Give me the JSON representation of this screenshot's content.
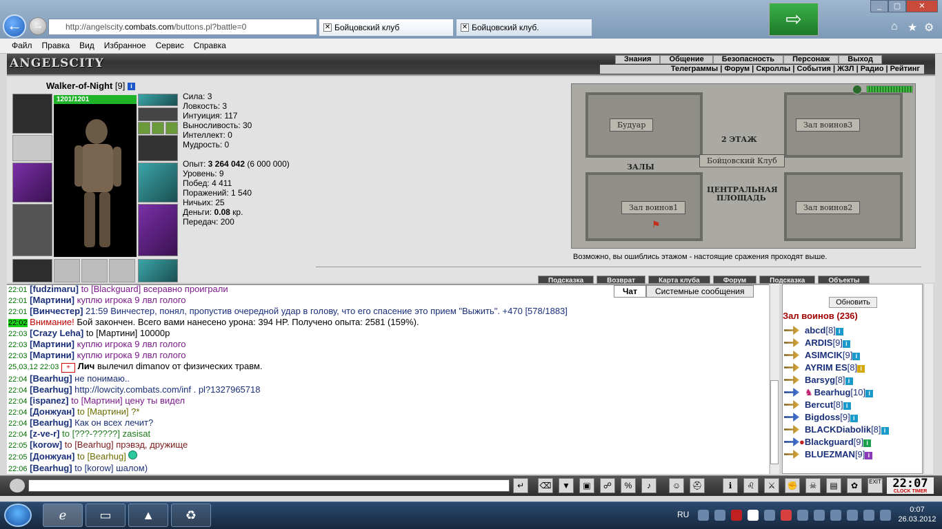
{
  "browser": {
    "address": "http://angelscity.combats.com/buttons.pl?battle=0",
    "address_prefix": "http://angelscity.",
    "address_host": "combats.com",
    "address_rest": "/buttons.pl?battle=0",
    "tabs": [
      {
        "label": "Бойцовский клуб"
      },
      {
        "label": "Бойцовский клуб."
      }
    ],
    "menu": [
      "Файл",
      "Правка",
      "Вид",
      "Избранное",
      "Сервис",
      "Справка"
    ]
  },
  "game": {
    "logo": "ANGELSCITY",
    "top_nav": [
      "Знания",
      "Общение",
      "Безопасность",
      "Персонаж",
      "Выход"
    ],
    "sub_nav": "Телеграммы | Форум | Скроллы | События | ЖЗЛ | Радио | Рейтинг",
    "character": {
      "name": "Walker-of-Night",
      "level": "[9]",
      "hp": "1201/1201",
      "stats": [
        "Сила: 3",
        "Ловкость: 3",
        "Интуиция: 117",
        "Выносливость: 30",
        "Интеллект: 0",
        "Мудрость: 0"
      ],
      "exp_label": "Опыт:",
      "exp_value": "3 264 042",
      "exp_next": "(6 000 000)",
      "info": [
        "Уровень: 9",
        "Побед: 4 411",
        "Поражений: 1 540",
        "Ничьих: 25"
      ],
      "money_label": "Деньги:",
      "money_value": "0.08",
      "money_unit": "кр.",
      "transfers": "Передач: 200"
    },
    "map": {
      "rooms": [
        "Будуар",
        "Зал воинов3",
        "Зал воинов1",
        "Зал воинов2"
      ],
      "center": "Бойцовский Клуб",
      "floor": "2 ЭТАЖ",
      "halls": "ЗАЛЫ",
      "square_line1": "ЦЕНТРАЛЬНАЯ",
      "square_line2": "ПЛОЩАДЬ",
      "note": "Возможно, вы ошиблись этажом - настоящие сражения проходят выше."
    },
    "bottom_buttons": [
      "Подсказка",
      "Возврат",
      "Карта клуба",
      "Форум",
      "Подсказка",
      "Объекты"
    ]
  },
  "chat": {
    "tabs": [
      "Чат",
      "Системные сообщения"
    ],
    "lines": [
      {
        "time": "22:01",
        "nick": "[fudzimaru]",
        "to": "to [Blackguard]",
        "text": "всеравно проиграли",
        "kind": "to"
      },
      {
        "time": "22:01",
        "nick": "[Мартини]",
        "to": "",
        "text": "куплю игрока 9 лвл голого",
        "kind": "to"
      },
      {
        "time": "22:01",
        "nick": "[Винчестер]",
        "to": "",
        "text": "21:59 Винчестер, понял, пропустив очередной удар в голову, что его спасение это прием \"Выжить\". +470 [578/1883]",
        "kind": "blue"
      },
      {
        "time": "22:02",
        "nick": "Внимание!",
        "to": "",
        "text": "Бой закончен. Всего вами нанесено урона: 394 HP. Получено опыта: 2581 (159%).",
        "kind": "sys"
      },
      {
        "time": "22:03",
        "nick": "[Crazy Leha]",
        "to": "to [Мартини]",
        "text": "10000р",
        "kind": "plain"
      },
      {
        "time": "22:03",
        "nick": "[Мартини]",
        "to": "",
        "text": "куплю игрока 9 лвл голого",
        "kind": "to"
      },
      {
        "time": "22:03",
        "nick": "[Мартини]",
        "to": "",
        "text": "куплю игрока 9 лвл голого",
        "kind": "to"
      },
      {
        "time": "25,03,12 22:03",
        "nick": "Лич",
        "to": "",
        "text": "вылечил dimanov от физических травм.",
        "kind": "plain"
      },
      {
        "time": "22:04",
        "nick": "[Bearhug]",
        "to": "",
        "text": "не понимаю..",
        "kind": "blue"
      },
      {
        "time": "22:04",
        "nick": "[Bearhug]",
        "to": "",
        "text": "http://lowcity.combats.com/inf . pl?1327965718",
        "kind": "blue"
      },
      {
        "time": "22:04",
        "nick": "[ispanez]",
        "to": "to [Мартини]",
        "text": "цену ты видел",
        "kind": "to"
      },
      {
        "time": "22:04",
        "nick": "[Донжуан]",
        "to": "to [Мартини]",
        "text": "?*",
        "kind": "olive"
      },
      {
        "time": "22:04",
        "nick": "[Bearhug]",
        "to": "",
        "text": "Как он всех лечит?",
        "kind": "blue"
      },
      {
        "time": "22:04",
        "nick": "[z-ve-r]",
        "to": "to [???-?????]",
        "text": "zasisat",
        "kind": "green"
      },
      {
        "time": "22:05",
        "nick": "[korow]",
        "to": "to [Bearhug]",
        "text": "прэвэд, дружище",
        "kind": "red"
      },
      {
        "time": "22:05",
        "nick": "[Донжуан]",
        "to": "to [Bearhug]",
        "text": "",
        "kind": "olive"
      },
      {
        "time": "22:06",
        "nick": "[Bearhug]",
        "to": "to [korow]",
        "text": "шалом)",
        "kind": "blue"
      }
    ]
  },
  "online": {
    "refresh": "Обновить",
    "title": "Зал воинов (236)",
    "users": [
      {
        "name": "abcd",
        "level": "[8]"
      },
      {
        "name": "ARDIS",
        "level": "[9]"
      },
      {
        "name": "ASIMCIK",
        "level": "[9]"
      },
      {
        "name": "AYRIM ES",
        "level": "[8]"
      },
      {
        "name": "Barsyg",
        "level": "[8]"
      },
      {
        "name": "Bearhug",
        "level": "[10]"
      },
      {
        "name": "Bercut",
        "level": "[8]"
      },
      {
        "name": "Bigdoss",
        "level": "[9]"
      },
      {
        "name": "BLACKDiabolik",
        "level": "[8]"
      },
      {
        "name": "Blackguard",
        "level": "[9]"
      },
      {
        "name": "BLUEZMAN",
        "level": "[9]"
      }
    ]
  },
  "toolbar": {
    "clock": "22:07",
    "clock_labels": "CLOCK TIMER",
    "exit": "EXIT"
  },
  "taskbar": {
    "lang": "RU",
    "time": "0:07",
    "date": "26.03.2012"
  }
}
